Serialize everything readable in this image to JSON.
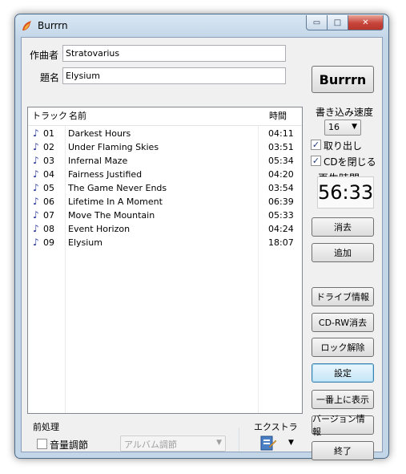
{
  "window": {
    "title": "Burrrn",
    "minimize_glyph": "▭",
    "maximize_glyph": "□",
    "close_glyph": "✕"
  },
  "fields": {
    "composer_label": "作曲者",
    "composer_value": "Stratovarius",
    "title_label": "題名",
    "title_value": "Elysium"
  },
  "burn_button": "Burrrn",
  "tracklist": {
    "headers": {
      "track": "トラック",
      "name": "名前",
      "time": "時間"
    },
    "rows": [
      {
        "no": "01",
        "name": "Darkest Hours",
        "time": "04:11"
      },
      {
        "no": "02",
        "name": "Under Flaming Skies",
        "time": "03:51"
      },
      {
        "no": "03",
        "name": "Infernal Maze",
        "time": "05:34"
      },
      {
        "no": "04",
        "name": "Fairness Justified",
        "time": "04:20"
      },
      {
        "no": "05",
        "name": "The Game Never Ends",
        "time": "03:54"
      },
      {
        "no": "06",
        "name": "Lifetime In A Moment",
        "time": "06:39"
      },
      {
        "no": "07",
        "name": "Move The Mountain",
        "time": "05:33"
      },
      {
        "no": "08",
        "name": "Event Horizon",
        "time": "04:24"
      },
      {
        "no": "09",
        "name": "Elysium",
        "time": "18:07"
      }
    ]
  },
  "side": {
    "write_speed_label": "書き込み速度",
    "write_speed_value": "16",
    "eject_label": "取り出し",
    "eject_checked": true,
    "close_cd_label": "CDを閉じる",
    "close_cd_checked": true,
    "playtime_label": "再生時間:",
    "playtime_value": "56:33"
  },
  "buttons": {
    "delete": "消去",
    "add": "追加",
    "drive_info": "ドライブ情報",
    "cdrw_erase": "CD-RW消去",
    "unlock": "ロック解除",
    "settings": "設定",
    "always_on_top": "一番上に表示",
    "version_info": "バージョン情報",
    "exit": "終了"
  },
  "preprocess": {
    "group_label": "前処理",
    "volume_label": "音量調節",
    "volume_checked": false,
    "mode_value": "アルバム調節"
  },
  "extra": {
    "group_label": "エクストラ"
  },
  "colors": {
    "note_icon": "#2b3a9a",
    "focus_border": "#3c7fb1"
  }
}
